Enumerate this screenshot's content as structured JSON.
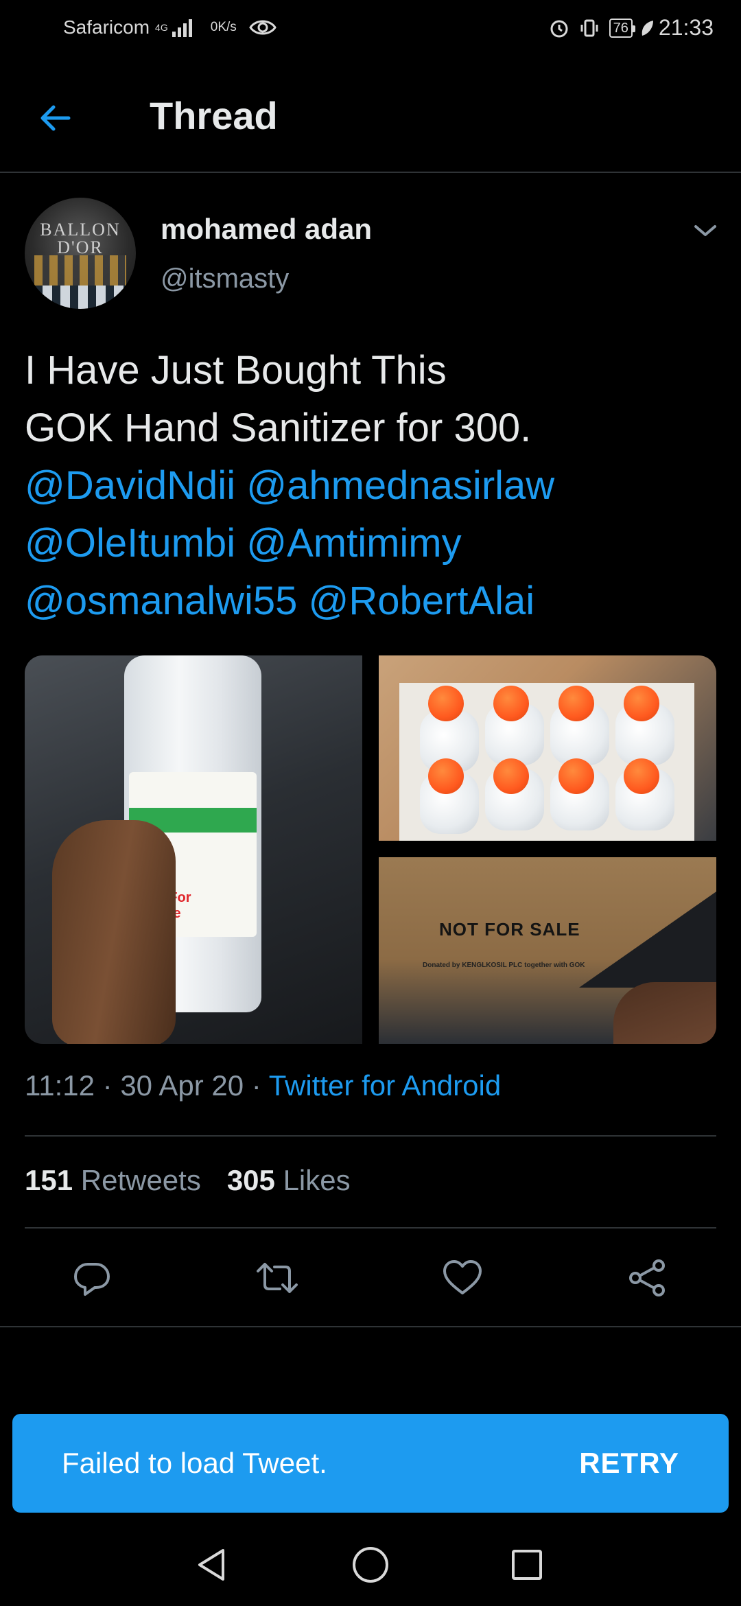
{
  "status_bar": {
    "carrier": "Safaricom",
    "network_type": "4G",
    "speed_value": "0",
    "speed_unit": "K/s",
    "battery": "76",
    "time": "21:33"
  },
  "header": {
    "title": "Thread",
    "back_icon": "arrow-left-icon"
  },
  "tweet": {
    "author_name": "mohamed adan",
    "author_handle": "@itsmasty",
    "avatar_text": "BALLON D'OR",
    "lines": [
      {
        "parts": [
          {
            "text": "I Have Just Bought This",
            "type": "text"
          }
        ]
      },
      {
        "parts": [
          {
            "text": "GOK Hand Sanitizer for 300.",
            "type": "text"
          }
        ]
      },
      {
        "parts": [
          {
            "text": "@DavidNdii",
            "type": "mention"
          },
          {
            "text": " ",
            "type": "text"
          },
          {
            "text": "@ahmednasirlaw",
            "type": "mention"
          }
        ]
      },
      {
        "parts": [
          {
            "text": "@OleItumbi",
            "type": "mention"
          },
          {
            "text": " ",
            "type": "text"
          },
          {
            "text": "@Amtimimy",
            "type": "mention"
          }
        ]
      },
      {
        "parts": [
          {
            "text": "@osmanalwi55",
            "type": "mention"
          },
          {
            "text": " ",
            "type": "text"
          },
          {
            "text": "@RobertAlai",
            "type": "mention"
          }
        ]
      }
    ],
    "media_texts": {
      "bottle_label": "Not For Sale",
      "box_label": "NOT FOR SALE",
      "box_small": "Donated by KENGLKOSIL PLC together with GOK"
    },
    "timestamp_time": "11:12",
    "timestamp_date": "30 Apr 20",
    "separator": " · ",
    "source": "Twitter for Android",
    "retweets_count": "151",
    "retweets_label": "Retweets",
    "likes_count": "305",
    "likes_label": "Likes"
  },
  "actions": {
    "reply_icon": "reply-icon",
    "retweet_icon": "retweet-icon",
    "like_icon": "heart-icon",
    "share_icon": "share-icon"
  },
  "snackbar": {
    "message": "Failed to load Tweet.",
    "action_label": "RETRY"
  },
  "colors": {
    "background": "#000000",
    "accent": "#1d9bf0",
    "secondary_text": "#8b98a5",
    "divider": "#2f3336"
  }
}
